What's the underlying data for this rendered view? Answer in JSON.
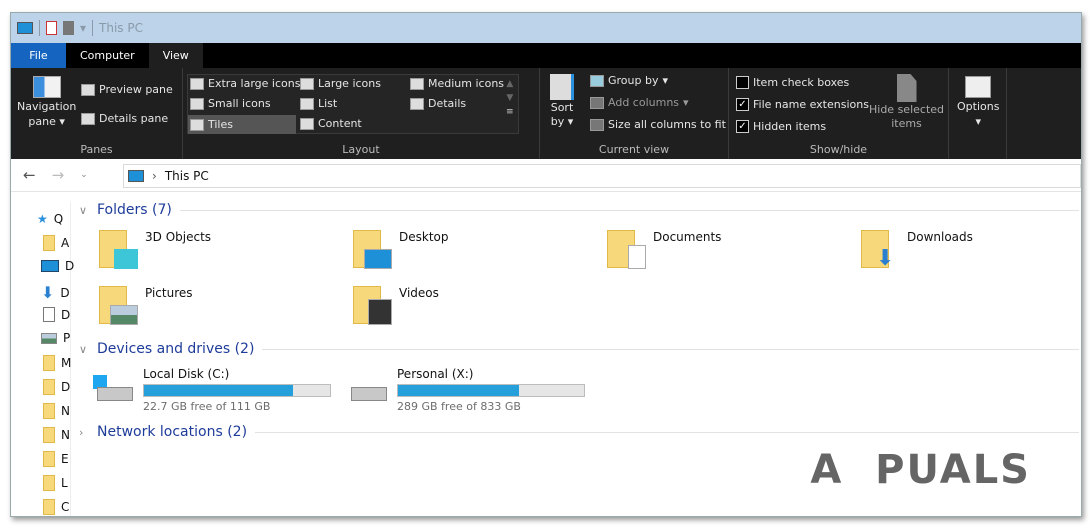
{
  "window": {
    "title": "This PC"
  },
  "tabs": [
    {
      "label": "File"
    },
    {
      "label": "Computer"
    },
    {
      "label": "View"
    }
  ],
  "ribbon": {
    "panes": {
      "label": "Panes",
      "navigation_pane": "Navigation",
      "navigation_pane2": "pane",
      "preview_pane": "Preview pane",
      "details_pane": "Details pane"
    },
    "layout": {
      "label": "Layout",
      "items": [
        "Extra large icons",
        "Large icons",
        "Medium icons",
        "Small icons",
        "List",
        "Details",
        "Tiles",
        "Content"
      ],
      "selected": "Tiles"
    },
    "current_view": {
      "label": "Current view",
      "sort_by": "Sort",
      "sort_by2": "by",
      "group_by": "Group by",
      "add_columns": "Add columns",
      "size_columns": "Size all columns to fit"
    },
    "show_hide": {
      "label": "Show/hide",
      "item_check_boxes": {
        "label": "Item check boxes",
        "checked": false
      },
      "file_name_extensions": {
        "label": "File name extensions",
        "checked": true
      },
      "hidden_items": {
        "label": "Hidden items",
        "checked": true
      },
      "hide_selected": "Hide selected",
      "hide_selected2": "items"
    },
    "options": {
      "label": "Options"
    }
  },
  "address": {
    "path": "This PC"
  },
  "sidebar": {
    "items": [
      "Q",
      "A",
      "D",
      "D",
      "D",
      "P",
      "M",
      "D",
      "N",
      "N",
      "E",
      "L",
      "C"
    ]
  },
  "sections": {
    "folders": "Folders (7)",
    "devices": "Devices and drives (2)",
    "network": "Network locations (2)"
  },
  "folders": [
    "3D Objects",
    "Desktop",
    "Documents",
    "Downloads",
    "Pictures",
    "Videos"
  ],
  "drives": [
    {
      "name": "Local Disk (C:)",
      "free": "22.7 GB free of 111 GB",
      "used_fraction": 0.8
    },
    {
      "name": "Personal (X:)",
      "free": "289 GB free of 833 GB",
      "used_fraction": 0.65
    }
  ],
  "colors": {
    "accent": "#1565c0",
    "bar": "#26a0da",
    "section": "#1e3c9a"
  },
  "watermark": "APPUALS"
}
